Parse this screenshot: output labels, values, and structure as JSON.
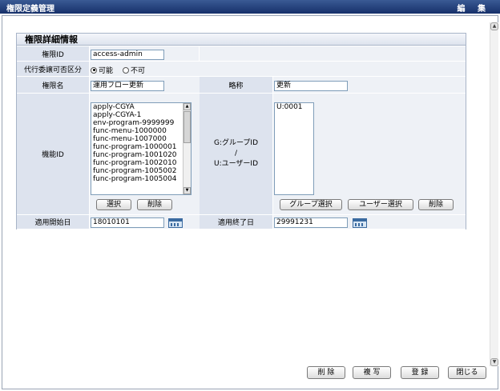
{
  "window": {
    "title": "権限定義管理",
    "mode": "編 集"
  },
  "panel": {
    "title": "権限詳細情報"
  },
  "fields": {
    "auth_id_label": "権限ID",
    "auth_id_value": "access-admin",
    "delegation_label": "代行委譲可否区分",
    "delegation_options": [
      "可能",
      "不可"
    ],
    "delegation_selected": "可能",
    "auth_name_label": "権限名",
    "auth_name_value": "運用フロー更新",
    "short_name_label": "略称",
    "short_name_value": "更新",
    "function_id_label": "機能ID",
    "function_ids": [
      "apply-CGYA",
      "apply-CGYA-1",
      "env-program-9999999",
      "func-menu-1000000",
      "func-menu-1007000",
      "func-program-1000001",
      "func-program-1001020",
      "func-program-1002010",
      "func-program-1005002",
      "func-program-1005004"
    ],
    "group_user_label_1": "G:グループID",
    "group_user_label_2": "/",
    "group_user_label_3": "U:ユーザーID",
    "group_user_items": [
      "U:0001"
    ],
    "start_date_label": "適用開始日",
    "start_date_value": "18010101",
    "end_date_label": "適用終了日",
    "end_date_value": "29991231"
  },
  "buttons": {
    "select": "選択",
    "delete_func": "削除",
    "group_select": "グループ選択",
    "user_select": "ユーザー選択",
    "delete_group": "削除"
  },
  "footer": {
    "delete": "削 除",
    "copy": "複 写",
    "register": "登 録",
    "close": "閉じる"
  }
}
